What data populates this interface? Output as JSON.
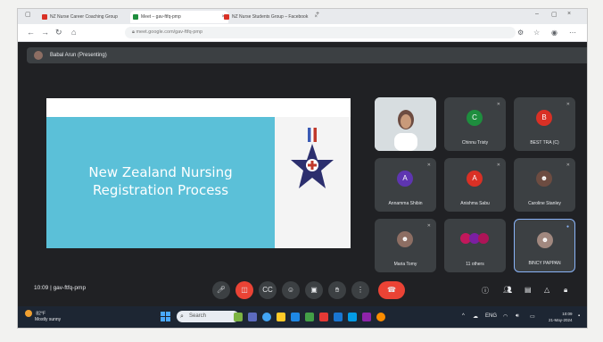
{
  "tabs": [
    {
      "label": "NZ Nurse Career Coaching Group",
      "active": false,
      "favicon_color": "#d93025"
    },
    {
      "label": "Meet – gav-ftfq-pmp",
      "active": true,
      "favicon_color": "#1e8e3e"
    },
    {
      "label": "NZ Nurse Students Group – Facebook",
      "active": false,
      "favicon_color": "#d93025"
    }
  ],
  "url": "meet.google.com/gav-ftfq-pmp",
  "presenter_bar": "Babal Arun (Presenting)",
  "slide": {
    "title_line1": "New Zealand Nursing",
    "title_line2": "Registration Process"
  },
  "participants": [
    {
      "name": "",
      "initial": "",
      "color": "",
      "type": "video"
    },
    {
      "name": "Chinnu Tristy",
      "initial": "C",
      "color": "#1e8e3e",
      "type": "avatar"
    },
    {
      "name": "BEST TRA (C)",
      "initial": "B",
      "color": "#d93025",
      "type": "avatar"
    },
    {
      "name": "Annamma Shibin",
      "initial": "A",
      "color": "#5e35b1",
      "type": "avatar"
    },
    {
      "name": "Anishma Sabu",
      "initial": "A",
      "color": "#d93025",
      "type": "avatar"
    },
    {
      "name": "Caroline Stanley",
      "initial": "",
      "color": "#6d4c41",
      "type": "photo"
    },
    {
      "name": "Maria Tomy",
      "initial": "",
      "color": "#8d6e63",
      "type": "photo"
    },
    {
      "name": "11 others",
      "initial": "",
      "color": "#c2185b",
      "type": "group"
    },
    {
      "name": "BINCY PAPPAN",
      "initial": "",
      "color": "#a1887f",
      "type": "photo"
    }
  ],
  "controls": {
    "meeting_info": "10:09  |  gav-ftfq-pmp"
  },
  "taskbar": {
    "weather_temp": "82°F",
    "weather_desc": "Mostly sunny",
    "search_placeholder": "Search",
    "time": "10:09",
    "date": "21-May-2024"
  }
}
